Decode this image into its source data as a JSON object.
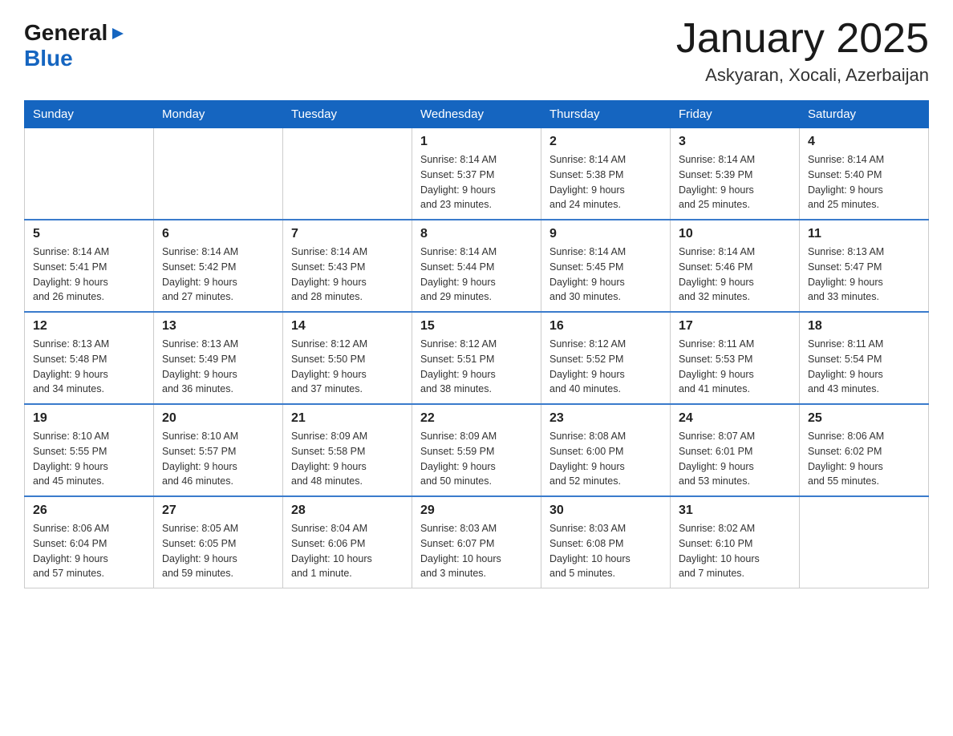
{
  "header": {
    "logo_line1": "General",
    "logo_arrow": "▶",
    "logo_line2": "Blue",
    "title": "January 2025",
    "subtitle": "Askyaran, Xocali, Azerbaijan"
  },
  "calendar": {
    "headers": [
      "Sunday",
      "Monday",
      "Tuesday",
      "Wednesday",
      "Thursday",
      "Friday",
      "Saturday"
    ],
    "rows": [
      [
        {
          "day": "",
          "info": ""
        },
        {
          "day": "",
          "info": ""
        },
        {
          "day": "",
          "info": ""
        },
        {
          "day": "1",
          "info": "Sunrise: 8:14 AM\nSunset: 5:37 PM\nDaylight: 9 hours\nand 23 minutes."
        },
        {
          "day": "2",
          "info": "Sunrise: 8:14 AM\nSunset: 5:38 PM\nDaylight: 9 hours\nand 24 minutes."
        },
        {
          "day": "3",
          "info": "Sunrise: 8:14 AM\nSunset: 5:39 PM\nDaylight: 9 hours\nand 25 minutes."
        },
        {
          "day": "4",
          "info": "Sunrise: 8:14 AM\nSunset: 5:40 PM\nDaylight: 9 hours\nand 25 minutes."
        }
      ],
      [
        {
          "day": "5",
          "info": "Sunrise: 8:14 AM\nSunset: 5:41 PM\nDaylight: 9 hours\nand 26 minutes."
        },
        {
          "day": "6",
          "info": "Sunrise: 8:14 AM\nSunset: 5:42 PM\nDaylight: 9 hours\nand 27 minutes."
        },
        {
          "day": "7",
          "info": "Sunrise: 8:14 AM\nSunset: 5:43 PM\nDaylight: 9 hours\nand 28 minutes."
        },
        {
          "day": "8",
          "info": "Sunrise: 8:14 AM\nSunset: 5:44 PM\nDaylight: 9 hours\nand 29 minutes."
        },
        {
          "day": "9",
          "info": "Sunrise: 8:14 AM\nSunset: 5:45 PM\nDaylight: 9 hours\nand 30 minutes."
        },
        {
          "day": "10",
          "info": "Sunrise: 8:14 AM\nSunset: 5:46 PM\nDaylight: 9 hours\nand 32 minutes."
        },
        {
          "day": "11",
          "info": "Sunrise: 8:13 AM\nSunset: 5:47 PM\nDaylight: 9 hours\nand 33 minutes."
        }
      ],
      [
        {
          "day": "12",
          "info": "Sunrise: 8:13 AM\nSunset: 5:48 PM\nDaylight: 9 hours\nand 34 minutes."
        },
        {
          "day": "13",
          "info": "Sunrise: 8:13 AM\nSunset: 5:49 PM\nDaylight: 9 hours\nand 36 minutes."
        },
        {
          "day": "14",
          "info": "Sunrise: 8:12 AM\nSunset: 5:50 PM\nDaylight: 9 hours\nand 37 minutes."
        },
        {
          "day": "15",
          "info": "Sunrise: 8:12 AM\nSunset: 5:51 PM\nDaylight: 9 hours\nand 38 minutes."
        },
        {
          "day": "16",
          "info": "Sunrise: 8:12 AM\nSunset: 5:52 PM\nDaylight: 9 hours\nand 40 minutes."
        },
        {
          "day": "17",
          "info": "Sunrise: 8:11 AM\nSunset: 5:53 PM\nDaylight: 9 hours\nand 41 minutes."
        },
        {
          "day": "18",
          "info": "Sunrise: 8:11 AM\nSunset: 5:54 PM\nDaylight: 9 hours\nand 43 minutes."
        }
      ],
      [
        {
          "day": "19",
          "info": "Sunrise: 8:10 AM\nSunset: 5:55 PM\nDaylight: 9 hours\nand 45 minutes."
        },
        {
          "day": "20",
          "info": "Sunrise: 8:10 AM\nSunset: 5:57 PM\nDaylight: 9 hours\nand 46 minutes."
        },
        {
          "day": "21",
          "info": "Sunrise: 8:09 AM\nSunset: 5:58 PM\nDaylight: 9 hours\nand 48 minutes."
        },
        {
          "day": "22",
          "info": "Sunrise: 8:09 AM\nSunset: 5:59 PM\nDaylight: 9 hours\nand 50 minutes."
        },
        {
          "day": "23",
          "info": "Sunrise: 8:08 AM\nSunset: 6:00 PM\nDaylight: 9 hours\nand 52 minutes."
        },
        {
          "day": "24",
          "info": "Sunrise: 8:07 AM\nSunset: 6:01 PM\nDaylight: 9 hours\nand 53 minutes."
        },
        {
          "day": "25",
          "info": "Sunrise: 8:06 AM\nSunset: 6:02 PM\nDaylight: 9 hours\nand 55 minutes."
        }
      ],
      [
        {
          "day": "26",
          "info": "Sunrise: 8:06 AM\nSunset: 6:04 PM\nDaylight: 9 hours\nand 57 minutes."
        },
        {
          "day": "27",
          "info": "Sunrise: 8:05 AM\nSunset: 6:05 PM\nDaylight: 9 hours\nand 59 minutes."
        },
        {
          "day": "28",
          "info": "Sunrise: 8:04 AM\nSunset: 6:06 PM\nDaylight: 10 hours\nand 1 minute."
        },
        {
          "day": "29",
          "info": "Sunrise: 8:03 AM\nSunset: 6:07 PM\nDaylight: 10 hours\nand 3 minutes."
        },
        {
          "day": "30",
          "info": "Sunrise: 8:03 AM\nSunset: 6:08 PM\nDaylight: 10 hours\nand 5 minutes."
        },
        {
          "day": "31",
          "info": "Sunrise: 8:02 AM\nSunset: 6:10 PM\nDaylight: 10 hours\nand 7 minutes."
        },
        {
          "day": "",
          "info": ""
        }
      ]
    ]
  }
}
